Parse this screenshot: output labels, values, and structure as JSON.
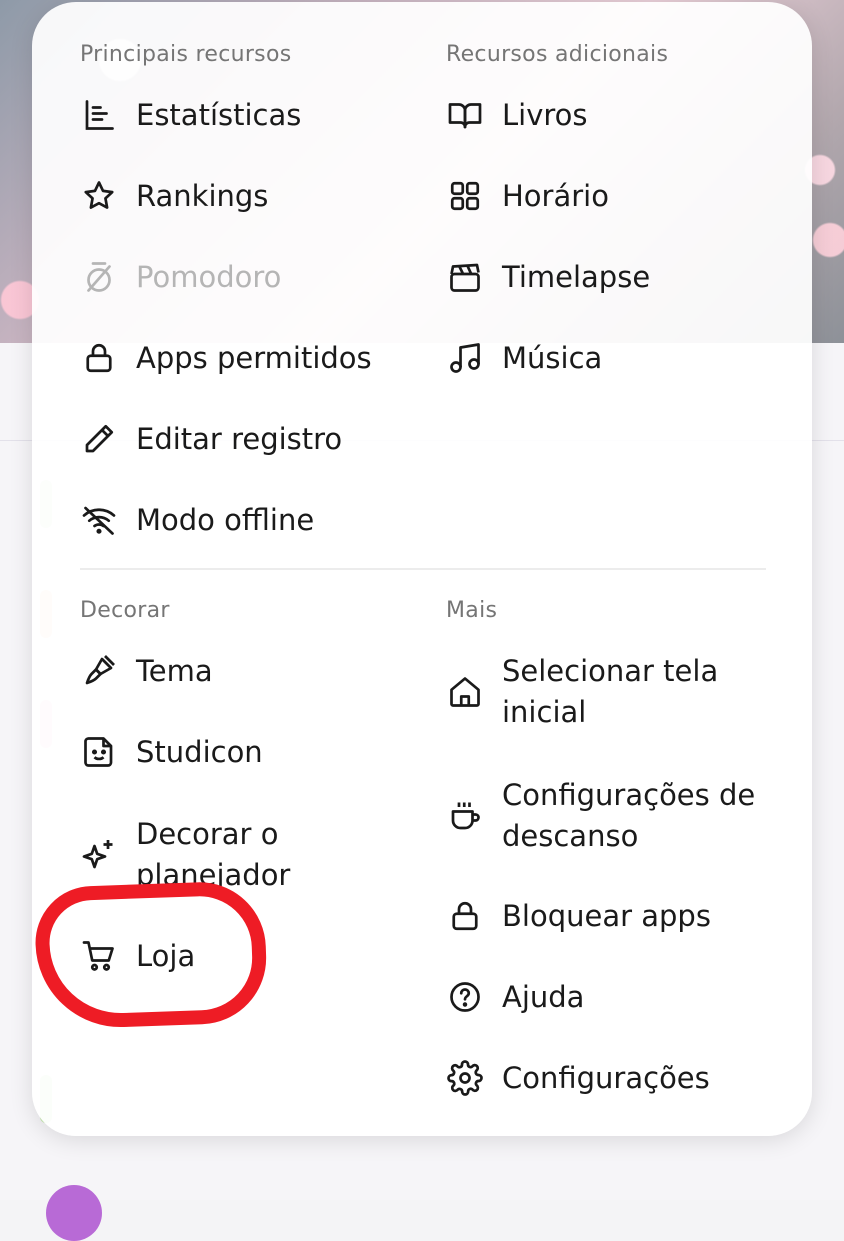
{
  "sections": {
    "main": {
      "title": "Principais recursos",
      "items": [
        {
          "label": "Estatísticas",
          "icon": "bar-chart-icon"
        },
        {
          "label": "Rankings",
          "icon": "star-icon"
        },
        {
          "label": "Pomodoro",
          "icon": "timer-off-icon",
          "disabled": true
        },
        {
          "label": "Apps permitidos",
          "icon": "lock-icon"
        },
        {
          "label": "Editar registro",
          "icon": "pencil-icon"
        },
        {
          "label": "Modo offline",
          "icon": "wifi-off-icon"
        }
      ]
    },
    "extra": {
      "title": "Recursos adicionais",
      "items": [
        {
          "label": "Livros",
          "icon": "book-icon"
        },
        {
          "label": "Horário",
          "icon": "grid-icon"
        },
        {
          "label": "Timelapse",
          "icon": "clapperboard-icon"
        },
        {
          "label": "Música",
          "icon": "music-note-icon"
        }
      ]
    },
    "decor": {
      "title": "Decorar",
      "items": [
        {
          "label": "Tema",
          "icon": "paintbrush-icon"
        },
        {
          "label": "Studicon",
          "icon": "sticker-icon"
        },
        {
          "label": "Decorar o planejador",
          "icon": "sparkles-icon"
        },
        {
          "label": "Loja",
          "icon": "cart-icon"
        }
      ]
    },
    "more": {
      "title": "Mais",
      "items": [
        {
          "label": "Selecionar tela inicial",
          "icon": "home-icon"
        },
        {
          "label": "Configurações de descanso",
          "icon": "coffee-cup-icon"
        },
        {
          "label": "Bloquear apps",
          "icon": "lock-icon"
        },
        {
          "label": "Ajuda",
          "icon": "help-circle-icon"
        },
        {
          "label": "Configurações",
          "icon": "gear-icon"
        }
      ]
    }
  },
  "annotation": {
    "color": "#ee1c25",
    "target": "Loja"
  }
}
